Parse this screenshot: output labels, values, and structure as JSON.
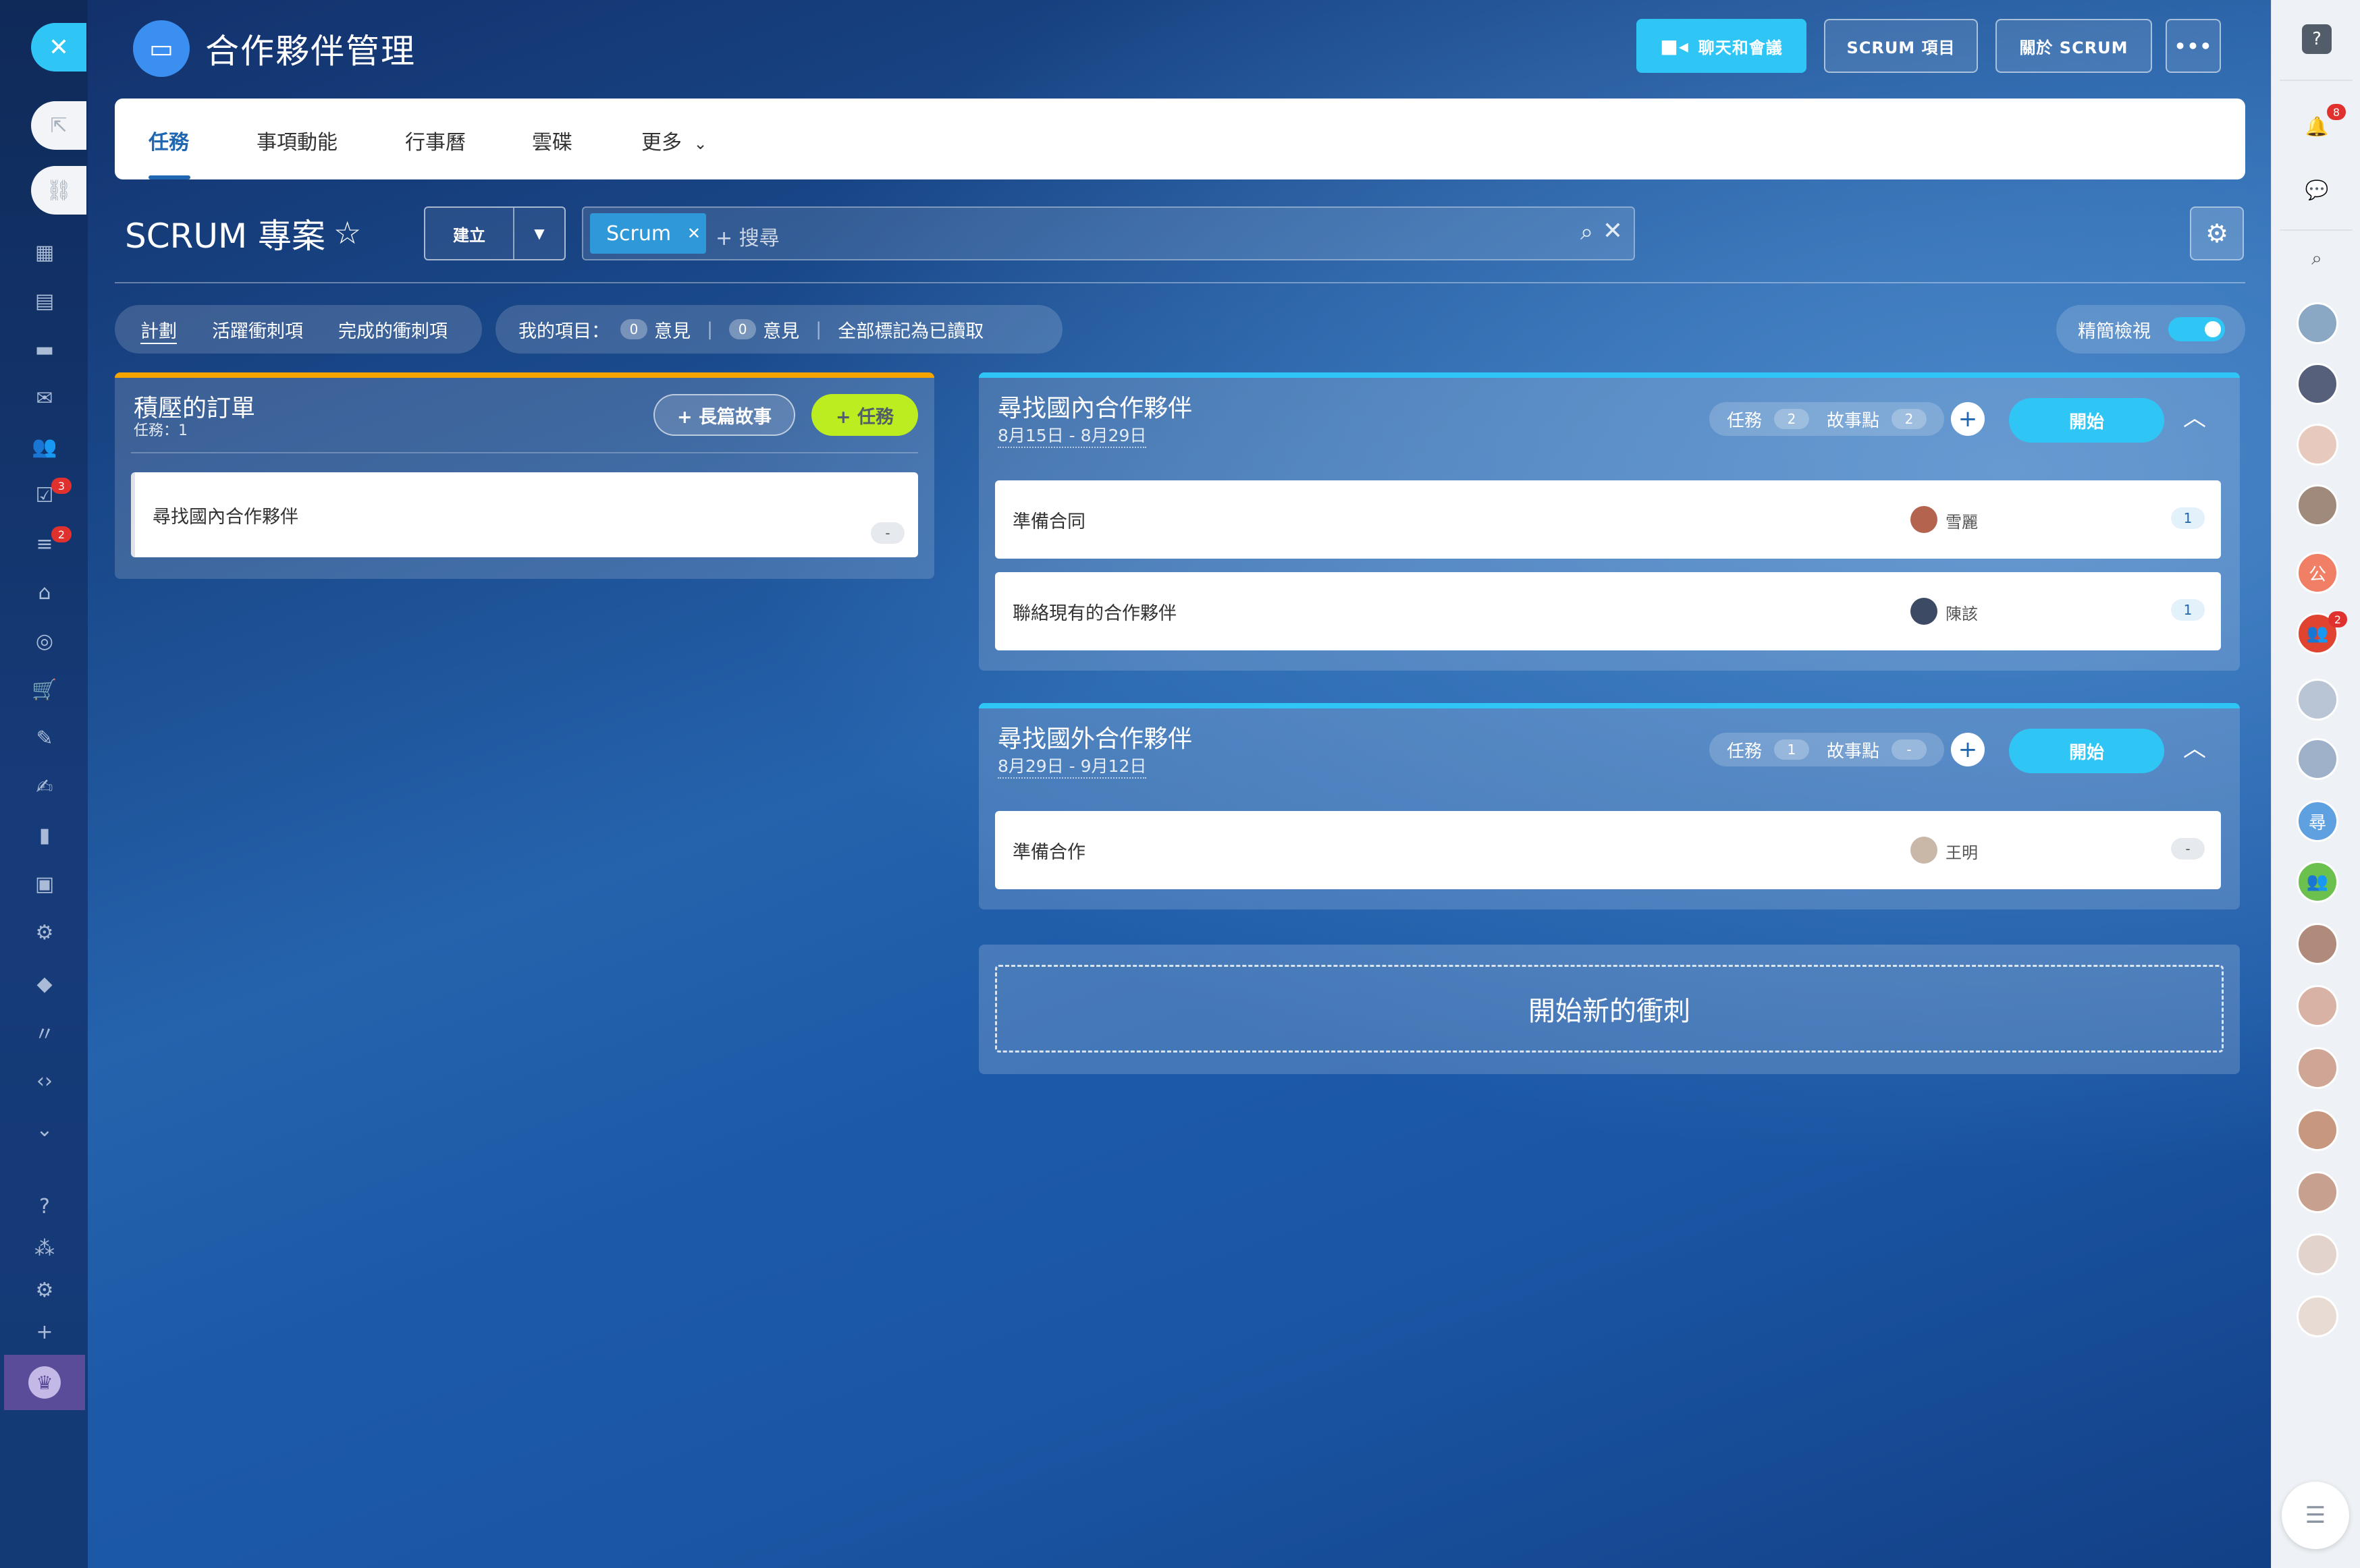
{
  "header": {
    "title": "合作夥伴管理",
    "buttons": {
      "chat": "聊天和會議",
      "scrum_items": "SCRUM 項目",
      "about_scrum": "關於 SCRUM",
      "more": "•••"
    }
  },
  "tabs": [
    {
      "label": "任務",
      "active": true
    },
    {
      "label": "事項動能"
    },
    {
      "label": "行事曆"
    },
    {
      "label": "雲碟"
    },
    {
      "label": "更多"
    }
  ],
  "toolbar": {
    "project_title": "SCRUM 專案",
    "create_label": "建立",
    "search_chip": "Scrum",
    "search_placeholder": "+ 搜尋"
  },
  "filters": {
    "views": [
      "計劃",
      "活躍衝刺項",
      "完成的衝刺項"
    ],
    "my_items_label": "我的項目：",
    "comments_1_count": "0",
    "comments_1_label": "意見",
    "comments_2_count": "0",
    "comments_2_label": "意見",
    "mark_all_read": "全部標記為已讀取",
    "compact_view": "精簡檢視",
    "compact_on": true
  },
  "backlog": {
    "title": "積壓的訂單",
    "subtitle": "任務：1",
    "epic_button": "+ 長篇故事",
    "task_button": "+ 任務",
    "items": [
      {
        "title": "尋找國內合作夥伴",
        "points": "-"
      }
    ]
  },
  "sprints": [
    {
      "title": "尋找國內合作夥伴",
      "dates": "8月15日 - 8月29日",
      "tasks_label": "任務",
      "tasks_count": "2",
      "points_label": "故事點",
      "points_count": "2",
      "start_label": "開始",
      "items": [
        {
          "title": "準備合同",
          "assignee": "雪麗",
          "points": "1"
        },
        {
          "title": "聯絡現有的合作夥伴",
          "assignee": "陳該",
          "points": "1"
        }
      ]
    },
    {
      "title": "尋找國外合作夥伴",
      "dates": "8月29日 - 9月12日",
      "tasks_label": "任務",
      "tasks_count": "1",
      "points_label": "故事點",
      "points_count": "-",
      "start_label": "開始",
      "items": [
        {
          "title": "準備合作",
          "assignee": "王明",
          "points": "-"
        }
      ]
    }
  ],
  "new_sprint_label": "開始新的衝刺",
  "left_sidebar": {
    "badges": {
      "tasks": "3",
      "filters": "2"
    }
  },
  "right_sidebar": {
    "notifications_badge": "8",
    "group_badge": "2",
    "avatar_letters": {
      "a5": "公",
      "a9": "尋"
    }
  },
  "colors": {
    "accent": "#2fc6f6",
    "backlog_top": "#f5a400",
    "task_button": "#bbed21",
    "tab_active": "#2066b0"
  }
}
